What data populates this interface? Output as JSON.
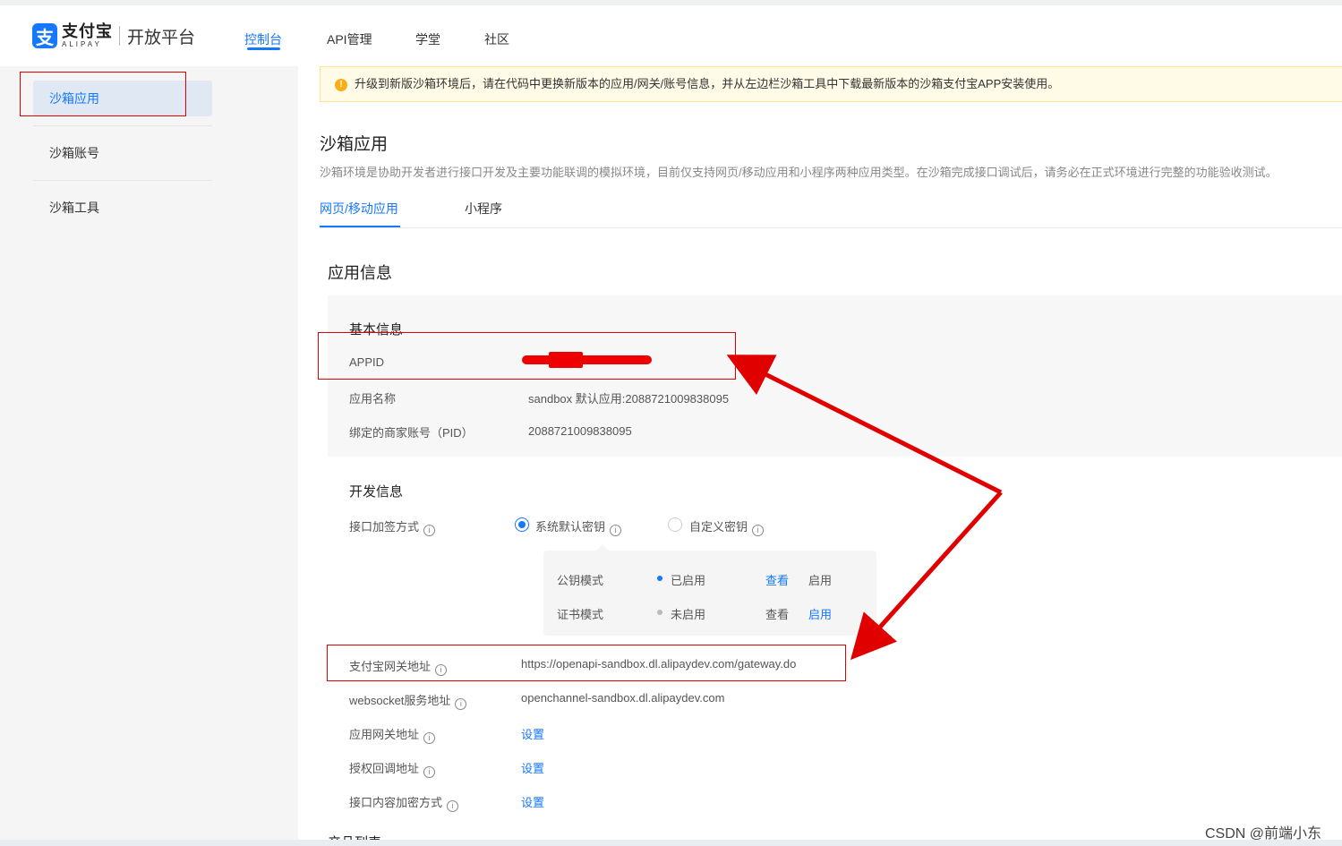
{
  "header": {
    "logo_cn": "支付宝",
    "logo_en": "ALIPAY",
    "platform": "开放平台",
    "nav": [
      {
        "label": "控制台",
        "active": true
      },
      {
        "label": "API管理",
        "active": false
      },
      {
        "label": "学堂",
        "active": false
      },
      {
        "label": "社区",
        "active": false
      }
    ]
  },
  "sidebar": {
    "items": [
      {
        "label": "沙箱应用",
        "active": true
      },
      {
        "label": "沙箱账号",
        "active": false
      },
      {
        "label": "沙箱工具",
        "active": false
      }
    ]
  },
  "notice": {
    "text": "升级到新版沙箱环境后，请在代码中更换新版本的应用/网关/账号信息，并从左边栏沙箱工具中下载最新版本的沙箱支付宝APP安装使用。"
  },
  "page": {
    "title": "沙箱应用",
    "description": "沙箱环境是协助开发者进行接口开发及主要功能联调的模拟环境，目前仅支持网页/移动应用和小程序两种应用类型。在沙箱完成接口调试后，请务必在正式环境进行完整的功能验收测试。",
    "tabs": [
      {
        "label": "网页/移动应用",
        "active": true
      },
      {
        "label": "小程序",
        "active": false
      }
    ]
  },
  "app_info": {
    "title": "应用信息",
    "basic": {
      "title": "基本信息",
      "appid_label": "APPID",
      "app_name_label": "应用名称",
      "app_name_value": "sandbox 默认应用:2088721009838095",
      "pid_label": "绑定的商家账号（PID）",
      "pid_value": "2088721009838095"
    },
    "dev": {
      "title": "开发信息",
      "sign_label": "接口加签方式",
      "sign_options": [
        {
          "label": "系统默认密钥",
          "checked": true
        },
        {
          "label": "自定义密钥",
          "checked": false
        }
      ],
      "modes": [
        {
          "name": "公钥模式",
          "status": "已启用",
          "status_color": "#1677ff",
          "view": "查看",
          "enable": "启用"
        },
        {
          "name": "证书模式",
          "status": "未启用",
          "status_color": "#bbbbbb",
          "view": "查看",
          "enable": "启用"
        }
      ],
      "gateway_label": "支付宝网关地址",
      "gateway_value": "https://openapi-sandbox.dl.alipaydev.com/gateway.do",
      "websocket_label": "websocket服务地址",
      "websocket_value": "openchannel-sandbox.dl.alipaydev.com",
      "app_gateway_label": "应用网关地址",
      "auth_callback_label": "授权回调地址",
      "encrypt_label": "接口内容加密方式",
      "set_link": "设置"
    },
    "next_section_partial": "产品列表"
  },
  "watermark": "CSDN @前端小东",
  "colors": {
    "brand": "#1677ff",
    "annotation": "#e00000",
    "notice_bg": "#fffbe6",
    "warn": "#faad14"
  }
}
